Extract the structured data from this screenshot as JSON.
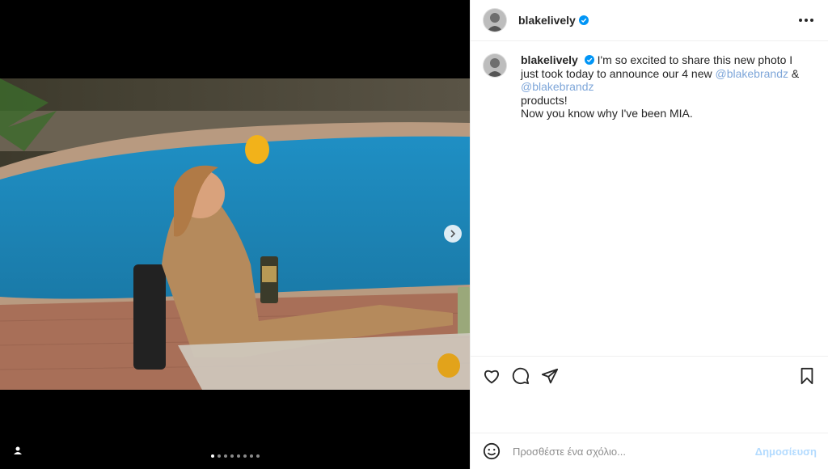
{
  "post": {
    "username": "blakelively",
    "caption_line1": " I'm so excited to share this new photo I just took today to announce our 4 new ",
    "mention1": "@blakebrandz",
    "amp": " & ",
    "mention2": "@blakebrandz",
    "caption_line2": " products!",
    "caption_line3": "Now you know why I've been MIA.",
    "carousel_total": 8,
    "carousel_active": 1
  },
  "actions": {
    "like_icon": "heart-icon",
    "comment_icon": "comment-icon",
    "share_icon": "share-icon",
    "save_icon": "bookmark-icon"
  },
  "comment_box": {
    "placeholder": "Προσθέστε ένα σχόλιο...",
    "post_label": "Δημοσίευση"
  },
  "colors": {
    "verified": "#0095f6",
    "link": "#00376b",
    "post_disabled": "#b3dbff"
  }
}
